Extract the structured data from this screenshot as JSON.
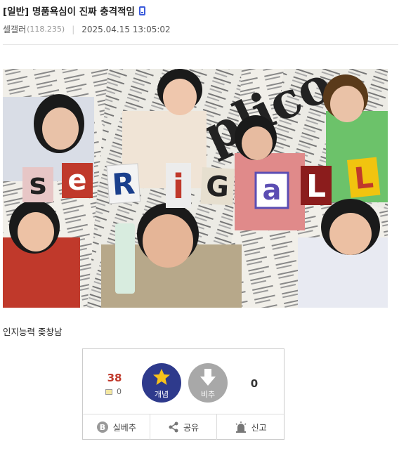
{
  "post": {
    "category": "[일반]",
    "title": "명품욕심이 진짜 충격적임",
    "author": "셀갤러",
    "author_ip": "(118.235)",
    "date": "2025.04.15 13:05:02",
    "body_text": "인지능력 좆창남"
  },
  "image": {
    "letters": [
      "s",
      "e",
      "R",
      "i",
      "G",
      "a",
      "L",
      "L"
    ]
  },
  "vote": {
    "up_count": "38",
    "fix_count": "0",
    "up_label": "개념",
    "down_label": "비추",
    "down_count": "0"
  },
  "actions": {
    "silbechu": "실베추",
    "share": "공유",
    "report": "신고"
  },
  "colors": {
    "up_button": "#2e3a8c",
    "down_button": "#a8a8a8",
    "up_count": "#c0392b",
    "mobile_icon": "#3b5bdb"
  }
}
